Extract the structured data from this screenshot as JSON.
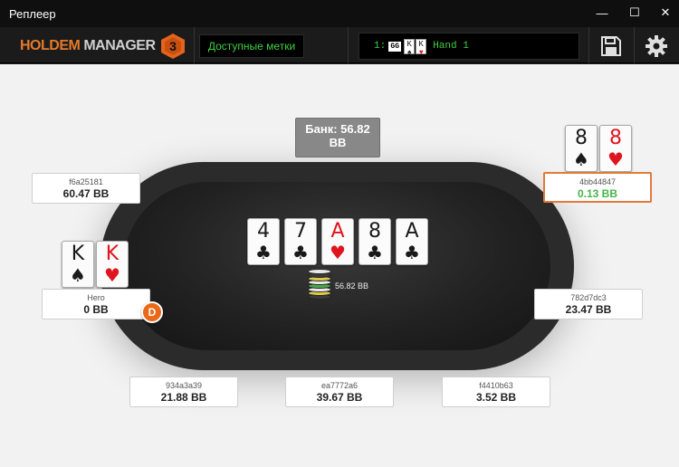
{
  "window": {
    "title": "Реплеер"
  },
  "window_controls": {
    "minimize": "—",
    "maximize": "☐",
    "close": "✕"
  },
  "toolbar": {
    "logo_word1": "HOLDEM",
    "logo_word2": "MANAGER",
    "logo_version": "3",
    "tags_label": "Доступные метки",
    "hand_index": "1:",
    "site_icon": "GG",
    "hand_cards": [
      {
        "rank": "K",
        "suit": "♠"
      },
      {
        "rank": "K",
        "suit": "♥"
      }
    ],
    "hand_label": "Hand 1",
    "save_icon": "floppy-disk-icon",
    "settings_icon": "gear-icon"
  },
  "table": {
    "pot_label": "Банк: 56.82 BB",
    "board": [
      {
        "rank": "4",
        "suit": "♣",
        "color": "black"
      },
      {
        "rank": "7",
        "suit": "♣",
        "color": "black"
      },
      {
        "rank": "A",
        "suit": "♥",
        "color": "red"
      },
      {
        "rank": "8",
        "suit": "♣",
        "color": "black"
      },
      {
        "rank": "A",
        "suit": "♣",
        "color": "black"
      }
    ],
    "chips_amount": "56.82 BB",
    "dealer_button": "D",
    "accent_color": "#e07a3c"
  },
  "seats": [
    {
      "name": "f6a25181",
      "stack": "60.47 BB"
    },
    {
      "name": "4bb44847",
      "stack": "0.13 BB",
      "cards": [
        {
          "rank": "8",
          "suit": "♠"
        },
        {
          "rank": "8",
          "suit": "♥"
        }
      ]
    },
    {
      "name": "Hero",
      "stack": "0 BB",
      "cards": [
        {
          "rank": "K",
          "suit": "♠"
        },
        {
          "rank": "K",
          "suit": "♥"
        }
      ]
    },
    {
      "name": "782d7dc3",
      "stack": "23.47 BB"
    },
    {
      "name": "934a3a39",
      "stack": "21.88 BB"
    },
    {
      "name": "ea7772a6",
      "stack": "39.67 BB"
    },
    {
      "name": "f4410b63",
      "stack": "3.52 BB"
    }
  ]
}
